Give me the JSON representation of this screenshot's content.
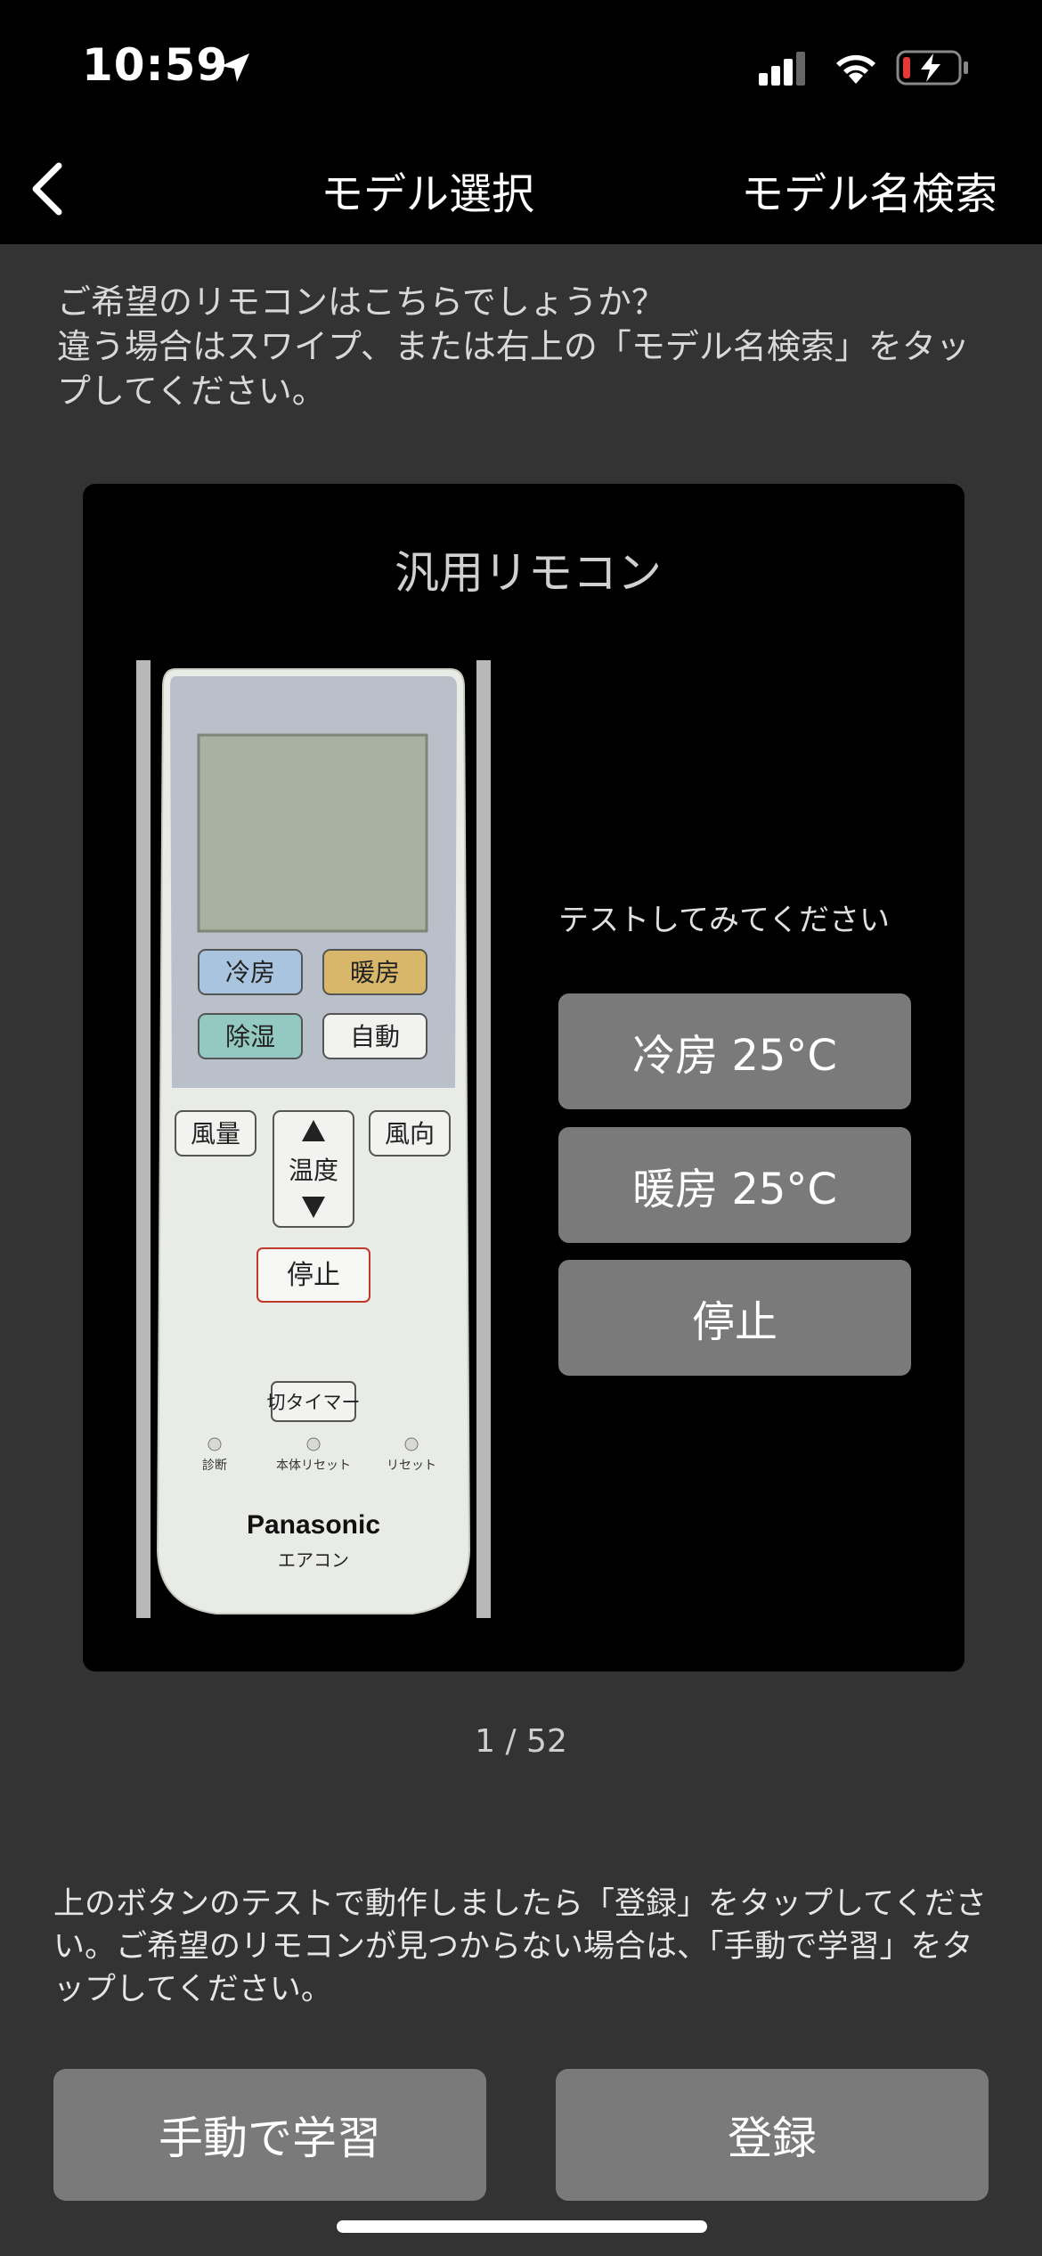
{
  "status": {
    "time": "10:59"
  },
  "nav": {
    "title": "モデル選択",
    "search": "モデル名検索"
  },
  "intro": {
    "line1": "ご希望のリモコンはこちらでしょうか？",
    "line2": "違う場合はスワイプ、または右上の「モデル名検索」をタップしてください。"
  },
  "card": {
    "title": "汎用リモコン",
    "test_label": "テストしてみてください",
    "buttons": {
      "cool": "冷房 25°C",
      "heat": "暖房 25°C",
      "stop": "停止"
    }
  },
  "remote": {
    "cool": "冷房",
    "heat": "暖房",
    "dehumidify": "除湿",
    "auto": "自動",
    "fan": "風量",
    "temp": "温度",
    "direction": "風向",
    "stop": "停止",
    "timer": "切タイマー",
    "diag": "診断",
    "body_reset": "本体リセット",
    "reset": "リセット",
    "brand": "Panasonic",
    "product": "エアコン"
  },
  "pager": {
    "text": "1 / 52"
  },
  "instruction": {
    "text": "上のボタンのテストで動作しましたら「登録」をタップしてください。ご希望のリモコンが見つからない場合は、「手動で学習」をタップしてください。"
  },
  "actions": {
    "manual": "手動で学習",
    "register": "登録"
  }
}
